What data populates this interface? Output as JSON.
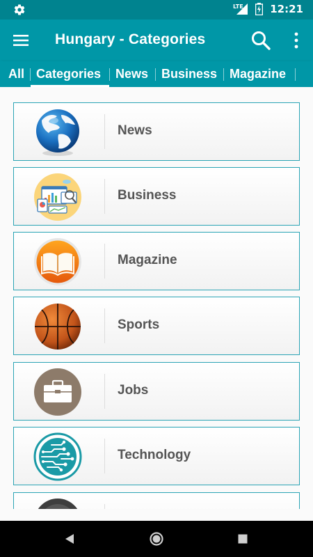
{
  "status_bar": {
    "time": "12:21",
    "network": "LTE",
    "icons": [
      "settings-icon",
      "signal-icon",
      "battery-icon"
    ]
  },
  "app_bar": {
    "title": "Hungary - Categories",
    "icons": [
      "menu-icon",
      "search-icon",
      "more-vert-icon"
    ]
  },
  "tabs": [
    {
      "label": "All",
      "selected": false
    },
    {
      "label": "Categories",
      "selected": true
    },
    {
      "label": "News",
      "selected": false
    },
    {
      "label": "Business",
      "selected": false
    },
    {
      "label": "Magazine",
      "selected": false
    }
  ],
  "categories": [
    {
      "label": "News",
      "icon": "globe-icon"
    },
    {
      "label": "Business",
      "icon": "business-chart-icon"
    },
    {
      "label": "Magazine",
      "icon": "open-book-icon"
    },
    {
      "label": "Sports",
      "icon": "basketball-icon"
    },
    {
      "label": "Jobs",
      "icon": "briefcase-icon"
    },
    {
      "label": "Technology",
      "icon": "circuit-icon"
    },
    {
      "label": "",
      "icon": "partial-category-icon"
    }
  ],
  "nav_bar": {
    "icons": [
      "back-icon",
      "home-icon",
      "recents-icon"
    ]
  },
  "colors": {
    "status_bar": "#00838f",
    "primary": "#0097a7",
    "card_border": "#29a3b4",
    "label_text": "#555555"
  }
}
